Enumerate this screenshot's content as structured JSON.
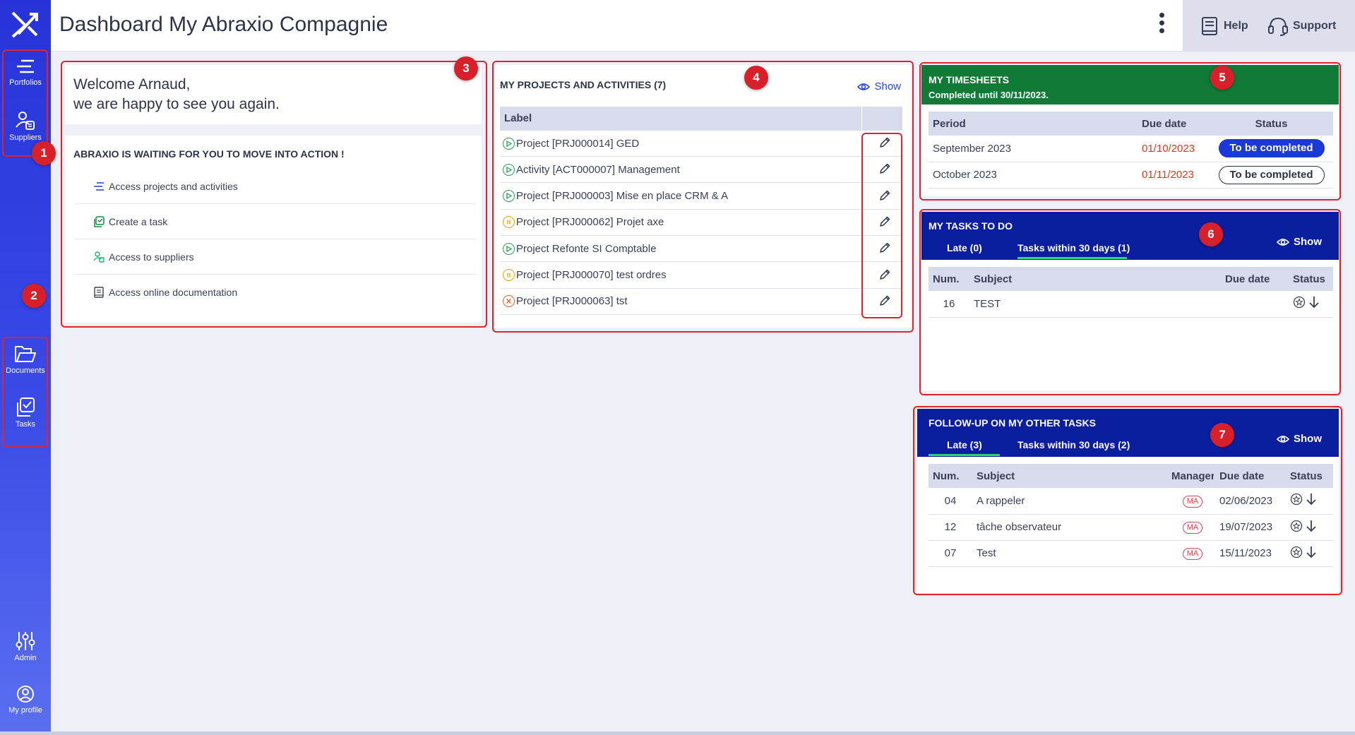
{
  "app": {
    "page_title": "Dashboard My Abraxio Compagnie"
  },
  "sidebar": {
    "items": [
      {
        "label": "Portfolios",
        "icon": "portfolios-icon"
      },
      {
        "label": "Suppliers",
        "icon": "suppliers-icon"
      },
      {
        "label": "Documents",
        "icon": "folder-icon"
      },
      {
        "label": "Tasks",
        "icon": "tasks-icon"
      },
      {
        "label": "Admin",
        "icon": "sliders-icon"
      },
      {
        "label": "My profile",
        "icon": "profile-icon"
      }
    ]
  },
  "header": {
    "help_label": "Help",
    "support_label": "Support"
  },
  "badges": [
    "1",
    "2",
    "3",
    "4",
    "5",
    "6",
    "7"
  ],
  "welcome": {
    "line1": "Welcome Arnaud,",
    "line2": "we are happy to see you again.",
    "section_title": "ABRAXIO IS WAITING FOR YOU TO MOVE INTO ACTION !",
    "actions": [
      {
        "label": "Access projects and activities",
        "icon": "portfolios-icon"
      },
      {
        "label": "Create a task",
        "icon": "tasks-icon"
      },
      {
        "label": "Access to suppliers",
        "icon": "suppliers-icon"
      },
      {
        "label": "Access online documentation",
        "icon": "book-icon"
      }
    ]
  },
  "projects": {
    "title": "MY PROJECTS AND ACTIVITIES (7)",
    "show_label": "Show",
    "column_label": "Label",
    "rows": [
      {
        "label": "Project [PRJ000014] GED",
        "status": "play"
      },
      {
        "label": "Activity [ACT000007] Management",
        "status": "play"
      },
      {
        "label": "Project [PRJ000003] Mise en place CRM & A",
        "status": "play"
      },
      {
        "label": "Project [PRJ000062] Projet axe",
        "status": "pause"
      },
      {
        "label": "Project Refonte SI Comptable",
        "status": "play"
      },
      {
        "label": "Project [PRJ000070] test ordres",
        "status": "pause"
      },
      {
        "label": "Project [PRJ000063] tst",
        "status": "cancel"
      }
    ]
  },
  "timesheets": {
    "title": "MY TIMESHEETS",
    "subtitle": "Completed until 30/11/2023.",
    "columns": [
      "Period",
      "Due date",
      "Status"
    ],
    "rows": [
      {
        "period": "September 2023",
        "due": "01/10/2023",
        "status": "To be completed",
        "style": "filled"
      },
      {
        "period": "October 2023",
        "due": "01/11/2023",
        "status": "To be completed",
        "style": "outline"
      }
    ],
    "header_color": "#117a36"
  },
  "tasks_todo": {
    "title": "MY TASKS TO DO",
    "show_label": "Show",
    "tabs": [
      "Late (0)",
      "Tasks within 30 days (1)"
    ],
    "active_tab": 1,
    "columns": [
      "Num.",
      "Subject",
      "Due date",
      "Status"
    ],
    "rows": [
      {
        "num": "16",
        "subject": "TEST",
        "due": ""
      }
    ],
    "header_color": "#0b1ea0"
  },
  "followup": {
    "title": "FOLLOW-UP ON MY OTHER TASKS",
    "show_label": "Show",
    "tabs": [
      "Late (3)",
      "Tasks within 30 days (2)"
    ],
    "active_tab": 0,
    "columns": [
      "Num.",
      "Subject",
      "Manager",
      "Due date",
      "Status"
    ],
    "rows": [
      {
        "num": "04",
        "subject": "A rappeler",
        "manager": "MA",
        "due": "02/06/2023"
      },
      {
        "num": "12",
        "subject": "tâche observateur",
        "manager": "MA",
        "due": "19/07/2023"
      },
      {
        "num": "07",
        "subject": "Test",
        "manager": "MA",
        "due": "15/11/2023"
      }
    ]
  },
  "colors": {
    "accent": "#1b39d6",
    "highlight": "#e0242f",
    "late_date": "#e0391c",
    "tab_underline": "#2fd47a"
  }
}
